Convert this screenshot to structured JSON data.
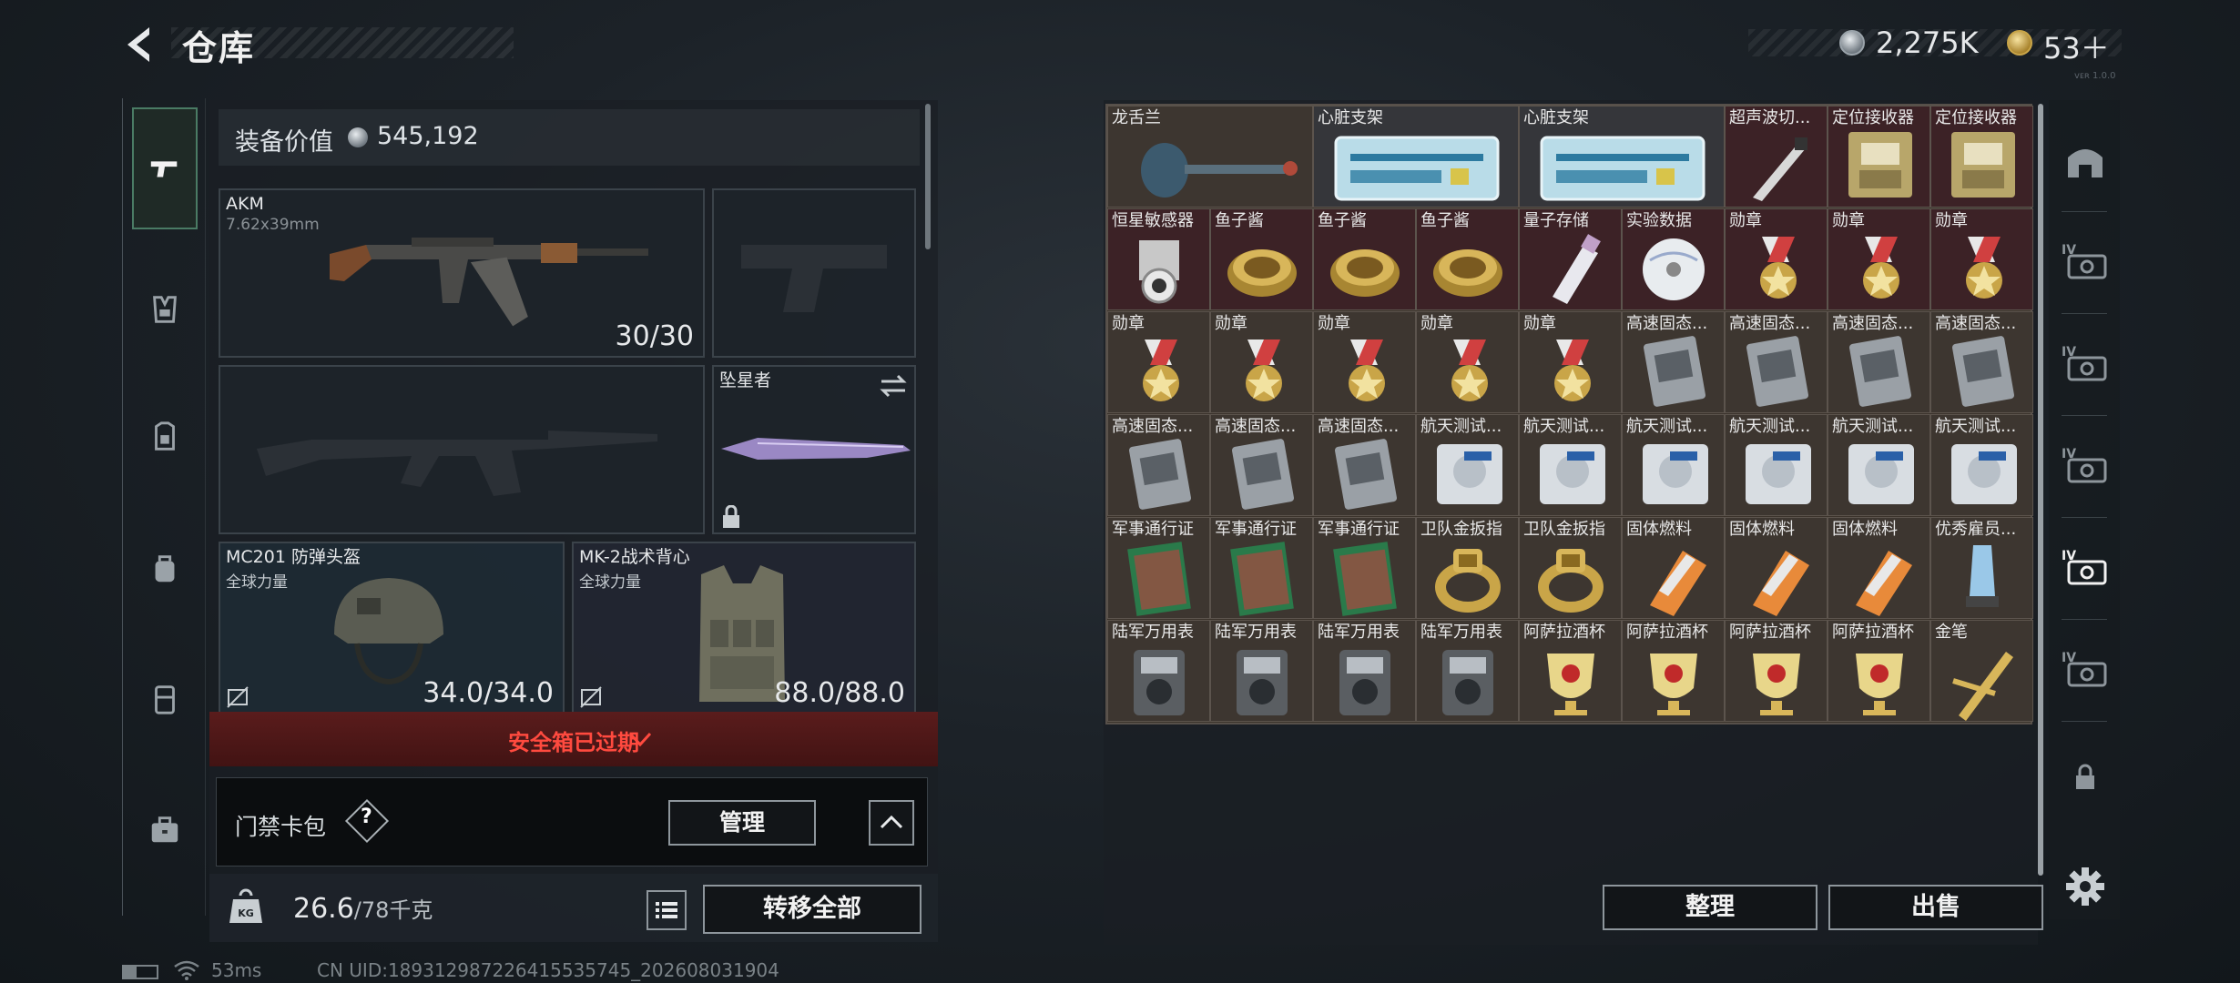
{
  "header": {
    "title": "仓库"
  },
  "currency": [
    {
      "icon": "silver-coin-icon",
      "value": "2,275K"
    },
    {
      "icon": "gold-coin-icon",
      "value": "53＋"
    }
  ],
  "version_text": "ᴠᴇʀ 1.0.0",
  "left_rail": [
    {
      "icon": "pistol-icon",
      "selected": true
    },
    {
      "icon": "vest-rig-icon"
    },
    {
      "icon": "armor-icon"
    },
    {
      "icon": "backpack-icon"
    },
    {
      "icon": "chest-rig-icon"
    },
    {
      "icon": "briefcase-icon"
    }
  ],
  "equipment": {
    "label": "装备价值",
    "value": "545,192",
    "primary": {
      "name": "AKM",
      "ammo": "7.62x39mm",
      "count": "30/30"
    },
    "sidearm": {
      "name": ""
    },
    "secondary": {
      "name": ""
    },
    "melee": {
      "name": "坠星者"
    },
    "helmet": {
      "name": "MC201 防弹头盔",
      "faction": "全球力量",
      "durability": "34.0/34.0"
    },
    "armor": {
      "name": "MK-2战术背心",
      "faction": "全球力量",
      "durability": "88.0/88.0"
    }
  },
  "safebox": {
    "text": "安全箱已过期"
  },
  "access_card": {
    "label": "门禁卡包",
    "help": "?",
    "manage_label": "管理"
  },
  "weight": {
    "current": "26.6",
    "max": "/78千克",
    "transfer_label": "转移全部"
  },
  "status": {
    "ping": "53ms",
    "uid": "CN UID:189312987226415535745_202608031904"
  },
  "stash": {
    "items": [
      {
        "name": "龙舌兰",
        "bg": "brown",
        "icon": "bottle-icon",
        "wide": true
      },
      {
        "name": "心脏支架",
        "bg": "grey",
        "icon": "stent-kit-icon",
        "wide": true
      },
      {
        "name": "心脏支架",
        "bg": "grey",
        "icon": "stent-kit-icon",
        "wide": true
      },
      {
        "name": "超声波切...",
        "bg": "red",
        "icon": "scalpel-icon"
      },
      {
        "name": "定位接收器",
        "bg": "red",
        "icon": "receiver-icon"
      },
      {
        "name": "定位接收器",
        "bg": "red",
        "icon": "receiver-icon"
      },
      {
        "name": "恒星敏感器",
        "bg": "red",
        "icon": "sensor-icon"
      },
      {
        "name": "鱼子酱",
        "bg": "red",
        "icon": "caviar-icon"
      },
      {
        "name": "鱼子酱",
        "bg": "red",
        "icon": "caviar-icon"
      },
      {
        "name": "鱼子酱",
        "bg": "red",
        "icon": "caviar-icon"
      },
      {
        "name": "量子存储",
        "bg": "red",
        "icon": "usb-drive-icon"
      },
      {
        "name": "实验数据",
        "bg": "red",
        "icon": "disc-icon"
      },
      {
        "name": "勋章",
        "bg": "red",
        "icon": "medal-icon"
      },
      {
        "name": "勋章",
        "bg": "red",
        "icon": "medal-icon"
      },
      {
        "name": "勋章",
        "bg": "red",
        "icon": "medal-icon"
      },
      {
        "name": "勋章",
        "bg": "brown",
        "icon": "medal-icon"
      },
      {
        "name": "勋章",
        "bg": "brown",
        "icon": "medal-icon"
      },
      {
        "name": "勋章",
        "bg": "brown",
        "icon": "medal-icon"
      },
      {
        "name": "勋章",
        "bg": "brown",
        "icon": "medal-icon"
      },
      {
        "name": "勋章",
        "bg": "brown",
        "icon": "medal-icon"
      },
      {
        "name": "高速固态...",
        "bg": "brown",
        "icon": "ssd-icon"
      },
      {
        "name": "高速固态...",
        "bg": "brown",
        "icon": "ssd-icon"
      },
      {
        "name": "高速固态...",
        "bg": "brown",
        "icon": "ssd-icon"
      },
      {
        "name": "高速固态...",
        "bg": "brown",
        "icon": "ssd-icon"
      },
      {
        "name": "高速固态...",
        "bg": "brown",
        "icon": "ssd-icon"
      },
      {
        "name": "高速固态...",
        "bg": "brown",
        "icon": "ssd-icon"
      },
      {
        "name": "高速固态...",
        "bg": "brown",
        "icon": "ssd-icon"
      },
      {
        "name": "航天测试...",
        "bg": "brown",
        "icon": "drive-icon"
      },
      {
        "name": "航天测试...",
        "bg": "brown",
        "icon": "drive-icon"
      },
      {
        "name": "航天测试...",
        "bg": "brown",
        "icon": "drive-icon"
      },
      {
        "name": "航天测试...",
        "bg": "brown",
        "icon": "drive-icon"
      },
      {
        "name": "航天测试...",
        "bg": "brown",
        "icon": "drive-icon"
      },
      {
        "name": "航天测试...",
        "bg": "brown",
        "icon": "drive-icon"
      },
      {
        "name": "军事通行证",
        "bg": "brown",
        "icon": "passport-icon"
      },
      {
        "name": "军事通行证",
        "bg": "brown",
        "icon": "passport-icon"
      },
      {
        "name": "军事通行证",
        "bg": "brown",
        "icon": "passport-icon"
      },
      {
        "name": "卫队金扳指",
        "bg": "brown",
        "icon": "gold-ring-icon"
      },
      {
        "name": "卫队金扳指",
        "bg": "brown",
        "icon": "gold-ring-icon"
      },
      {
        "name": "固体燃料",
        "bg": "brown",
        "icon": "fuel-icon"
      },
      {
        "name": "固体燃料",
        "bg": "brown",
        "icon": "fuel-icon"
      },
      {
        "name": "固体燃料",
        "bg": "brown",
        "icon": "fuel-icon"
      },
      {
        "name": "优秀雇员...",
        "bg": "brown",
        "icon": "trophy-icon"
      },
      {
        "name": "陆军万用表",
        "bg": "brown",
        "icon": "multimeter-icon"
      },
      {
        "name": "陆军万用表",
        "bg": "brown",
        "icon": "multimeter-icon"
      },
      {
        "name": "陆军万用表",
        "bg": "brown",
        "icon": "multimeter-icon"
      },
      {
        "name": "陆军万用表",
        "bg": "brown",
        "icon": "multimeter-icon"
      },
      {
        "name": "阿萨拉酒杯",
        "bg": "brown",
        "icon": "goblet-icon"
      },
      {
        "name": "阿萨拉酒杯",
        "bg": "brown",
        "icon": "goblet-icon"
      },
      {
        "name": "阿萨拉酒杯",
        "bg": "brown",
        "icon": "goblet-icon"
      },
      {
        "name": "阿萨拉酒杯",
        "bg": "brown",
        "icon": "goblet-icon"
      },
      {
        "name": "金笔",
        "bg": "brown",
        "icon": "gold-pen-icon"
      }
    ],
    "sort_label": "整理",
    "sell_label": "出售"
  },
  "right_rail": [
    {
      "icon": "stash-home-icon"
    },
    {
      "icon": "container-iv-icon",
      "label": "IV"
    },
    {
      "icon": "container-iv-icon",
      "label": "IV"
    },
    {
      "icon": "container-iv-icon",
      "label": "IV"
    },
    {
      "icon": "container-iv-icon",
      "label": "IV",
      "selected": true
    },
    {
      "icon": "container-iv-icon",
      "label": "IV"
    },
    {
      "icon": "lock-icon"
    },
    {
      "icon": "settings-gear-icon"
    }
  ]
}
